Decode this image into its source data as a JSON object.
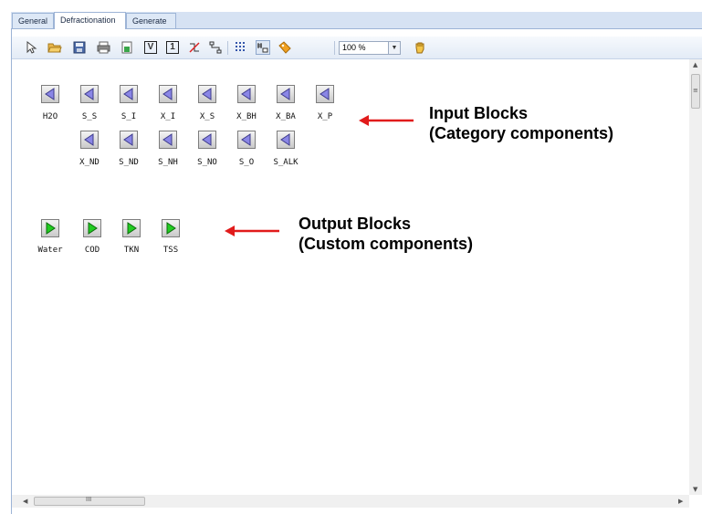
{
  "tabs": [
    {
      "label": "General",
      "active": false
    },
    {
      "label": "Defractionation",
      "active": true
    },
    {
      "label": "Generate",
      "active": false
    }
  ],
  "toolbar": {
    "tools": [
      "pointer-icon",
      "open-folder-icon",
      "save-icon",
      "print-icon",
      "export-icon",
      "v-block-icon",
      "one-block-icon",
      "connect-icon",
      "route-icon",
      "grid-icon",
      "snap-icon",
      "tag-icon",
      "pan-hand-icon"
    ],
    "v_label": "V",
    "one_label": "1",
    "zoom_value": "100 %"
  },
  "input_blocks": {
    "row1": [
      "H2O",
      "S_S",
      "S_I",
      "X_I",
      "X_S",
      "X_BH",
      "X_BA",
      "X_P"
    ],
    "row2": [
      "X_ND",
      "S_ND",
      "S_NH",
      "S_NO",
      "S_O",
      "S_ALK"
    ],
    "color": "#8a86e6"
  },
  "output_blocks": {
    "items": [
      "Water",
      "COD",
      "TKN",
      "TSS"
    ],
    "color": "#22cc22"
  },
  "annotations": {
    "input_line1": "Input Blocks",
    "input_line2": "(Category components)",
    "output_line1": "Output Blocks",
    "output_line2": "(Custom components)",
    "arrow_color": "#e11b1b"
  },
  "scrollbar": {
    "h_grip": "III",
    "v_grip": "≡"
  }
}
